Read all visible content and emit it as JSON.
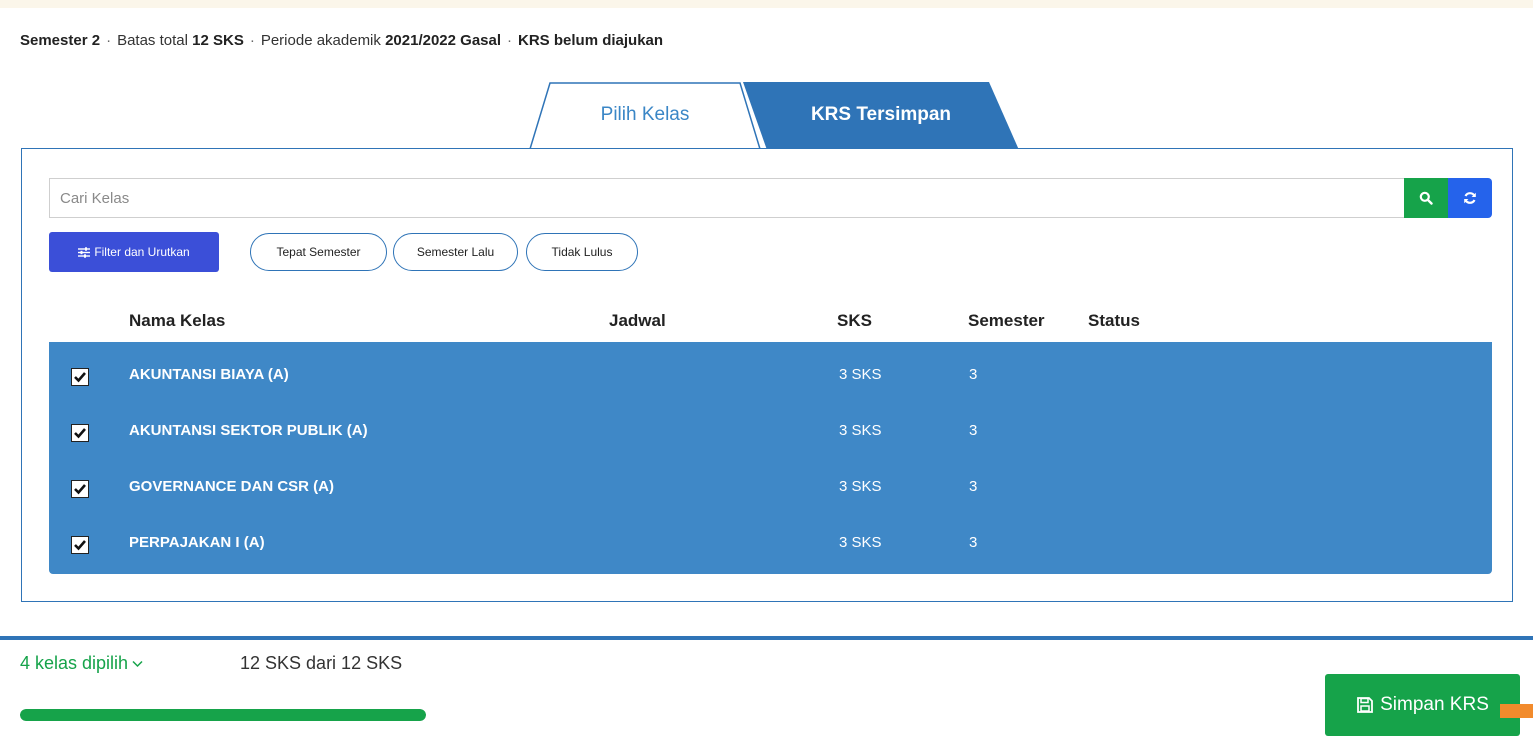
{
  "info": {
    "semester_prefix": "Semester",
    "semester_value": "2",
    "limit_prefix": "Batas total",
    "limit_value": "12 SKS",
    "period_prefix": "Periode akademik",
    "period_value": "2021/2022 Gasal",
    "status": "KRS belum diajukan",
    "separator": "·"
  },
  "tabs": [
    {
      "label": "Pilih Kelas",
      "active": true
    },
    {
      "label": "KRS Tersimpan",
      "active": false
    }
  ],
  "search": {
    "placeholder": "Cari Kelas",
    "value": ""
  },
  "filter_button": {
    "label": "Filter dan Urutkan",
    "icon": "sliders-icon"
  },
  "chips": [
    {
      "label": "Tepat Semester"
    },
    {
      "label": "Semester Lalu"
    },
    {
      "label": "Tidak Lulus"
    }
  ],
  "table": {
    "headers": {
      "name": "Nama Kelas",
      "schedule": "Jadwal",
      "sks": "SKS",
      "semester": "Semester",
      "status": "Status"
    },
    "rows": [
      {
        "name": "AKUNTANSI BIAYA (A)",
        "schedule": "",
        "sks": "3 SKS",
        "semester": "3",
        "status": "",
        "checked": true
      },
      {
        "name": "AKUNTANSI SEKTOR PUBLIK (A)",
        "schedule": "",
        "sks": "3 SKS",
        "semester": "3",
        "status": "",
        "checked": true
      },
      {
        "name": "GOVERNANCE DAN CSR (A)",
        "schedule": "",
        "sks": "3 SKS",
        "semester": "3",
        "status": "",
        "checked": true
      },
      {
        "name": "PERPAJAKAN I (A)",
        "schedule": "",
        "sks": "3 SKS",
        "semester": "3",
        "status": "",
        "checked": true
      }
    ]
  },
  "footer": {
    "selected_label": "4 kelas dipilih",
    "sks_summary": "12 SKS dari 12 SKS",
    "progress_fraction": 1.0,
    "save_label": "Simpan KRS"
  },
  "colors": {
    "primary": "#2f74b7",
    "row_selected": "#3f88c7",
    "success": "#16a34a",
    "filter": "#3b4fd8",
    "refresh": "#2563eb",
    "accent_orange": "#f28b2c"
  }
}
